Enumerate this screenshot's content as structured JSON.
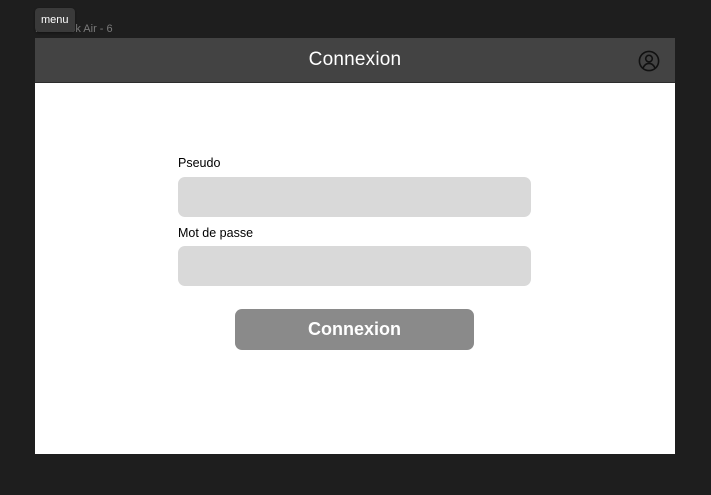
{
  "canvas": {
    "frame_label": "MacBook Air - 6",
    "menu_label": "menu"
  },
  "header": {
    "title": "Connexion",
    "profile_icon": "user-circle-icon"
  },
  "form": {
    "username": {
      "label": "Pseudo",
      "value": "",
      "placeholder": ""
    },
    "password": {
      "label": "Mot de passe",
      "value": "",
      "placeholder": ""
    },
    "submit_label": "Connexion"
  },
  "colors": {
    "canvas_background": "#1e1e1e",
    "header_background": "#434343",
    "input_background": "#d9d9d9",
    "button_background": "#8a8a8a"
  }
}
